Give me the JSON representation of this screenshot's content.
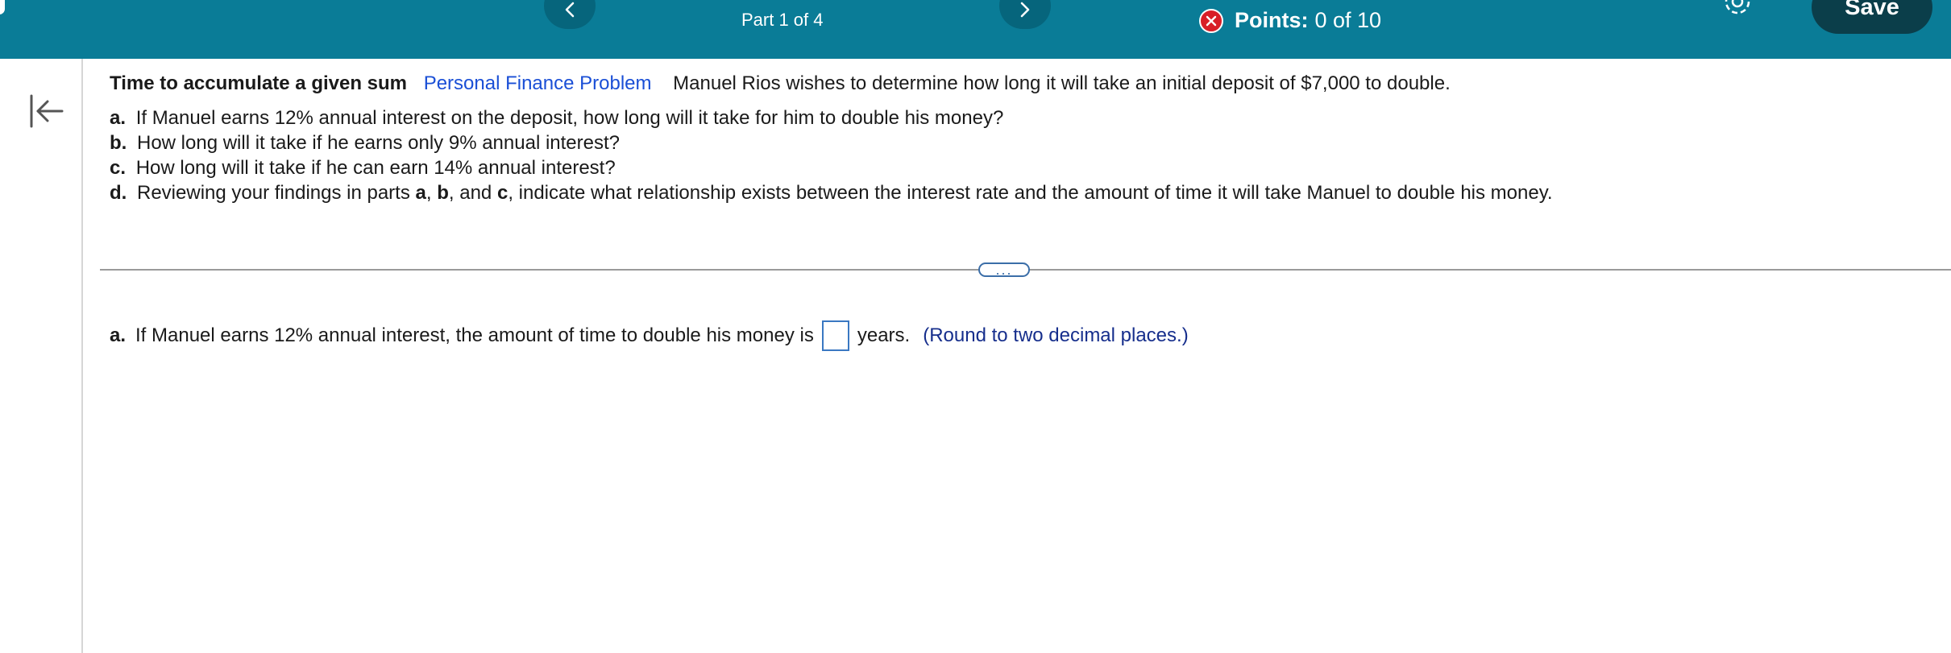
{
  "header": {
    "part_label": "Part 1 of 4",
    "points_label": "Points:",
    "points_value": "0 of 10",
    "save_label": "Save",
    "colors": {
      "bar": "#0a7c97",
      "save": "#0b3e4a",
      "error": "#d81e27"
    }
  },
  "problem": {
    "title": "Time to accumulate a given sum",
    "category": "Personal Finance Problem",
    "statement": "Manuel Rios wishes to determine how long it will take an initial deposit of $7,000 to double.",
    "questions": [
      {
        "label": "a.",
        "text": "If Manuel earns 12% annual interest on the deposit, how long will it take for him to double his money?"
      },
      {
        "label": "b.",
        "text": "How long will it take if he earns only 9% annual interest?"
      },
      {
        "label": "c.",
        "text": "How long will it take if he can earn 14% annual interest?"
      }
    ],
    "question_d": {
      "label": "d.",
      "text_before": "Reviewing your findings in parts",
      "part_a": "a",
      "sep1": ",",
      "part_b": "b",
      "sep2": ", and",
      "part_c": "c",
      "text_after": ", indicate what relationship exists between the interest rate and the amount of time it will take Manuel to double his money."
    }
  },
  "divider": {
    "more_label": "..."
  },
  "answer": {
    "label": "a.",
    "text_before": "If Manuel earns 12% annual interest, the amount of time to double his money is",
    "input_value": "",
    "text_after": "years.",
    "hint": "(Round to two decimal places.)"
  },
  "icons": [
    "chevron-left-icon",
    "chevron-right-icon",
    "close-circle-icon",
    "gear-icon",
    "collapse-left-icon"
  ]
}
